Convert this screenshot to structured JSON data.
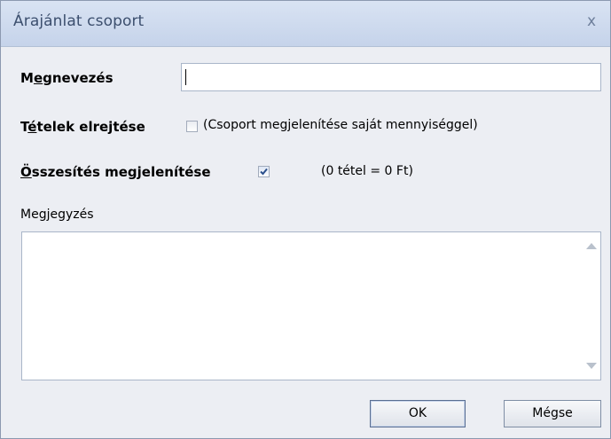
{
  "window": {
    "title": "Árajánlat csoport",
    "close_glyph": "x"
  },
  "fields": {
    "name_label_pre": "M",
    "name_label_ul": "e",
    "name_label_post": "gnevezés",
    "name_value": "",
    "hide_items_label_pre": "T",
    "hide_items_label_ul": "é",
    "hide_items_label_post": "telek elrejtése",
    "hide_items_checked": false,
    "hide_items_hint": "(Csoport megjelenítése saját mennyiséggel)",
    "summary_label_ul": "Ö",
    "summary_label_post": "sszesítés megjelenítése",
    "summary_checked": true,
    "summary_info": "(0 tétel = 0 Ft)",
    "notes_label": "Megjegyzés",
    "notes_value": ""
  },
  "buttons": {
    "ok_label": "OK",
    "cancel_label": "Mégse"
  },
  "colors": {
    "titlebar": "#c9d6ec",
    "title_text": "#3c4f6e",
    "checkmark": "#2b4f8c"
  }
}
